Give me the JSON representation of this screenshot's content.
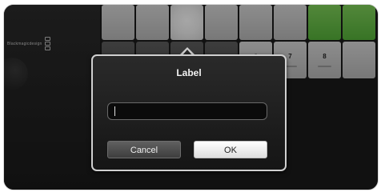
{
  "brand": {
    "name": "Blackmagicdesign"
  },
  "grid": {
    "top_row": [
      {
        "state": "grey"
      },
      {
        "state": "grey"
      },
      {
        "state": "lit"
      },
      {
        "state": "grey"
      },
      {
        "state": "grey"
      },
      {
        "state": "grey"
      },
      {
        "state": "green"
      },
      {
        "state": "green"
      }
    ],
    "bottom_row": [
      {
        "label": ""
      },
      {
        "label": ""
      },
      {
        "label": ""
      },
      {
        "label": ""
      },
      {
        "label": "6"
      },
      {
        "label": "7"
      },
      {
        "label": "8"
      },
      {
        "label": ""
      }
    ]
  },
  "dialog": {
    "title": "Label",
    "input_value": "",
    "cancel_label": "Cancel",
    "ok_label": "OK"
  }
}
